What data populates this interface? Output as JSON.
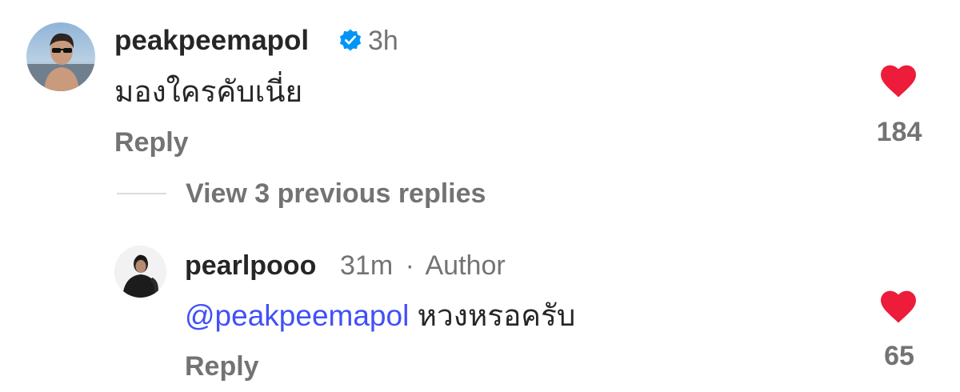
{
  "comment": {
    "username": "peakpeemapol",
    "verified_icon": "verified-badge-icon",
    "time": "3h",
    "text": "มองใครคับเนี่ย",
    "reply_label": "Reply",
    "like_icon": "heart-filled-icon",
    "like_count": "184"
  },
  "view_replies": {
    "label": "View 3 previous replies"
  },
  "reply": {
    "username": "pearlpooo",
    "time": "31m",
    "separator": "·",
    "author_label": "Author",
    "mention": "@peakpeemapol",
    "text": "หวงหรอครับ",
    "reply_label": "Reply",
    "like_icon": "heart-filled-icon",
    "like_count": "65"
  },
  "colors": {
    "heart": "#ED1C3A",
    "verified": "#0095F6",
    "mention": "#4150F7",
    "secondary_text": "#737373",
    "primary_text": "#262626"
  }
}
